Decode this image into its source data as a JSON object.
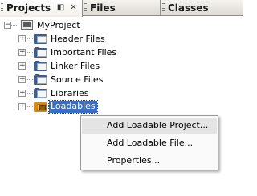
{
  "tabs": {
    "projects": "Projects",
    "files": "Files",
    "classes": "Classes"
  },
  "tree": {
    "root": "MyProject",
    "folders": [
      {
        "label": "Header Files",
        "icon": "folder-icon"
      },
      {
        "label": "Important Files",
        "icon": "folder-icon"
      },
      {
        "label": "Linker Files",
        "icon": "folder-icon"
      },
      {
        "label": "Source Files",
        "icon": "folder-icon"
      },
      {
        "label": "Libraries",
        "icon": "folder-icon"
      },
      {
        "label": "Loadables",
        "icon": "loadables-folder-icon",
        "selected": true
      }
    ]
  },
  "context_menu": {
    "items": [
      {
        "label": "Add Loadable Project...",
        "highlighted": true
      },
      {
        "label": "Add Loadable File..."
      },
      {
        "label": "Properties..."
      }
    ]
  }
}
